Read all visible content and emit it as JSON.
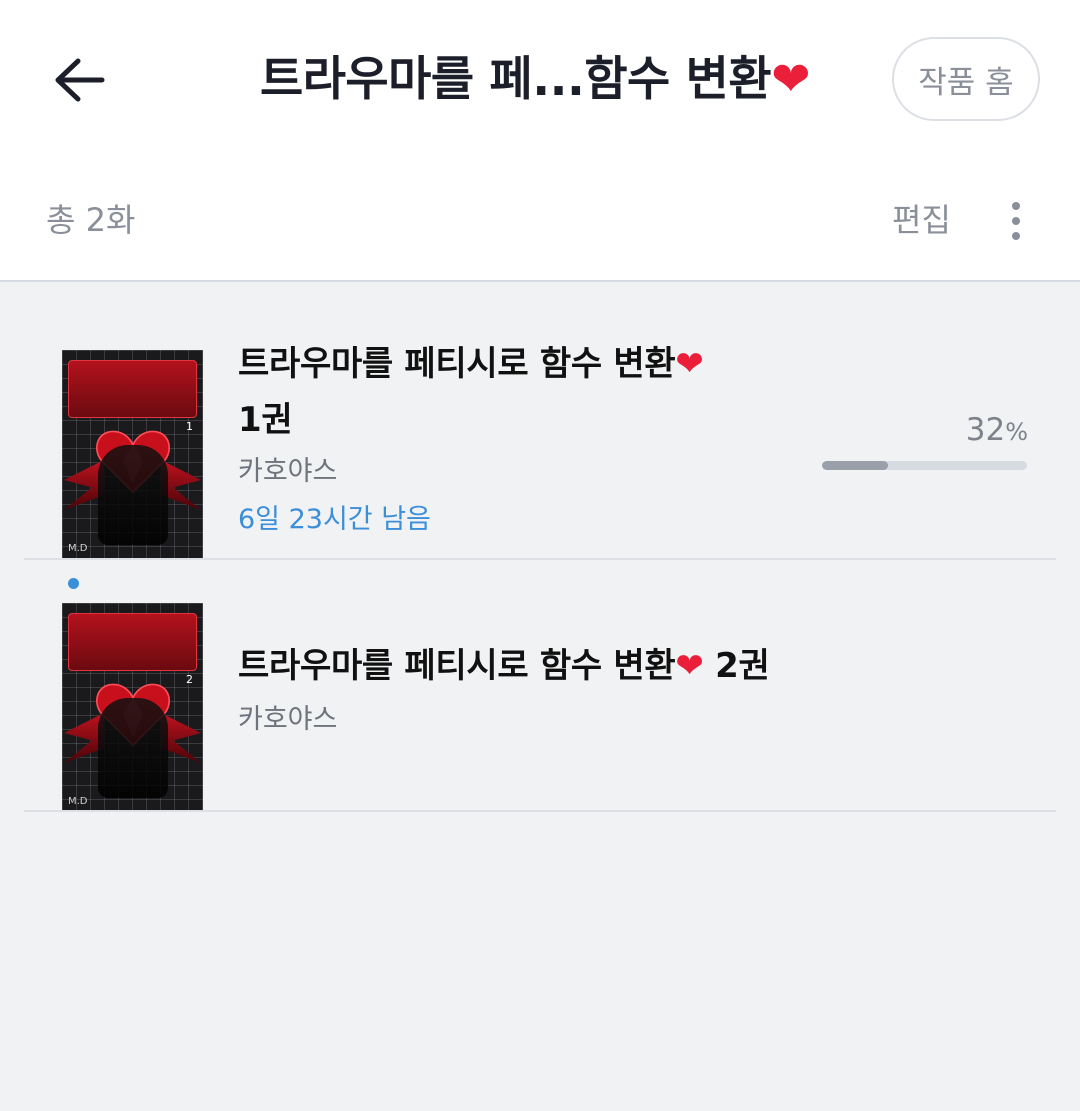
{
  "header": {
    "title": "트라우마를 페...함수 변환",
    "title_heart": "❤",
    "home_label": "작품 홈"
  },
  "subheader": {
    "total_count": "총 2화",
    "edit_label": "편집"
  },
  "colors": {
    "accent_blue": "#3b8fd8",
    "heart_red": "#ec1f3a",
    "text_gray": "#8a8f99"
  },
  "items": [
    {
      "title": "트라우마를 페티시로 함수 변환",
      "heart": "❤",
      "volume": "1권",
      "author": "카호야스",
      "remaining": "6일 23시간 남음",
      "progress_value": "32",
      "progress_unit": "%",
      "progress_fraction": 0.32,
      "cover_volume": "1",
      "cover_publisher": "M.D"
    },
    {
      "title": "트라우마를 페티시로 함수 변환",
      "heart": "❤",
      "volume": "2권",
      "author": "카호야스",
      "is_new": true,
      "cover_volume": "2",
      "cover_publisher": "M.D"
    }
  ],
  "icons": {
    "back": "arrow-left-icon",
    "more": "more-vertical-icon"
  }
}
